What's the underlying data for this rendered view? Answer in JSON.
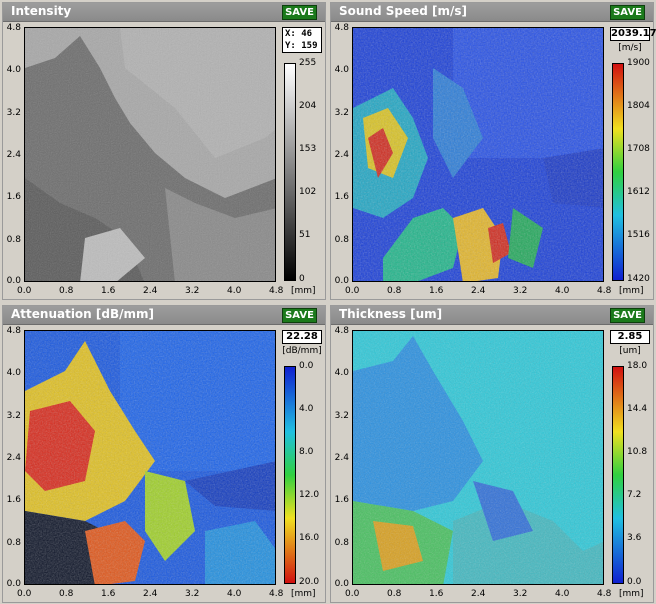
{
  "panels": [
    {
      "title": "Intensity",
      "save_label": "SAVE",
      "readout_x": "X: 46",
      "readout_y": "Y: 159",
      "colorbar_ticks": [
        "255",
        "204",
        "153",
        "102",
        "51",
        "0"
      ]
    },
    {
      "title": "Sound Speed [m/s]",
      "save_label": "SAVE",
      "readout_value": "2039.17",
      "unit": "[m/s]",
      "colorbar_ticks": [
        "1900",
        "1804",
        "1708",
        "1612",
        "1516",
        "1420"
      ]
    },
    {
      "title": "Attenuation [dB/mm]",
      "save_label": "SAVE",
      "readout_value": "22.28",
      "unit": "[dB/mm]",
      "colorbar_ticks": [
        "0.0",
        "4.0",
        "8.0",
        "12.0",
        "16.0",
        "20.0"
      ]
    },
    {
      "title": "Thickness [um]",
      "save_label": "SAVE",
      "readout_value": "2.85",
      "unit": "[um]",
      "colorbar_ticks": [
        "18.0",
        "14.4",
        "10.8",
        "7.2",
        "3.6",
        "0.0"
      ]
    }
  ],
  "axis": {
    "y_ticks": [
      "4.8",
      "4.0",
      "3.2",
      "2.4",
      "1.6",
      "0.8",
      "0.0"
    ],
    "x_ticks": [
      "0.0",
      "0.8",
      "1.6",
      "2.4",
      "3.2",
      "4.0",
      "4.8"
    ],
    "unit": "[mm]"
  },
  "colors": {
    "save_button": "#1b7a1b",
    "titlebar": "#8f8f8f",
    "background": "#d4d0c8"
  }
}
